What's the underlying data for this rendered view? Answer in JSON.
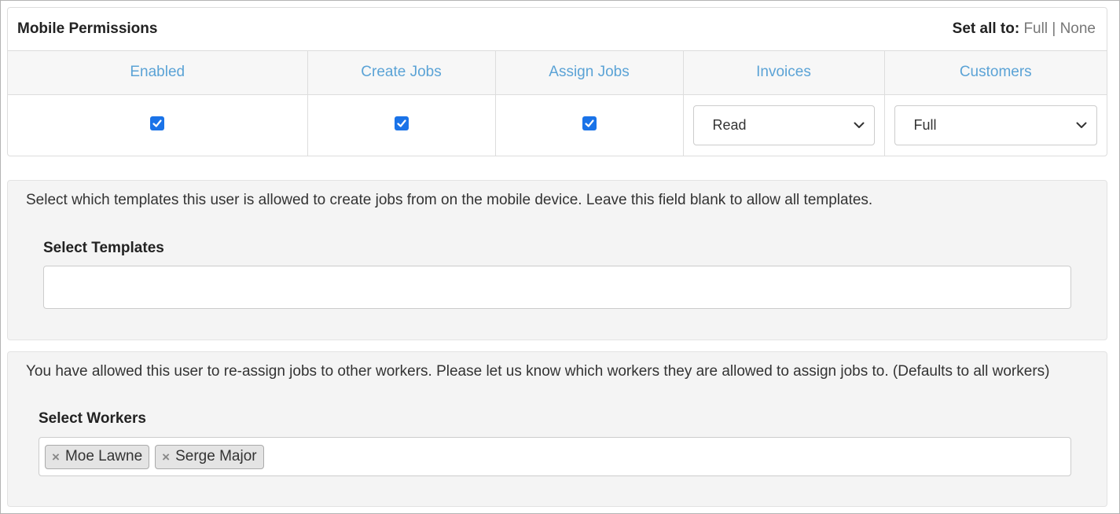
{
  "permissions": {
    "title": "Mobile Permissions",
    "set_all_label": "Set all to:",
    "set_all_full": "Full",
    "set_all_separator": "|",
    "set_all_none": "None",
    "columns": [
      "Enabled",
      "Create Jobs",
      "Assign Jobs",
      "Invoices",
      "Customers"
    ],
    "values": {
      "enabled": true,
      "create_jobs": true,
      "assign_jobs": true,
      "invoices": "Read",
      "customers": "Full"
    }
  },
  "templates": {
    "description": "Select which templates this user is allowed to create jobs from on the mobile device. Leave this field blank to allow all templates.",
    "label": "Select Templates",
    "value": ""
  },
  "workers": {
    "description": "You have allowed this user to re-assign jobs to other workers. Please let us know which workers they are allowed to assign jobs to. (Defaults to all workers)",
    "label": "Select Workers",
    "selected": [
      "Moe Lawne",
      "Serge Major"
    ],
    "remove_glyph": "×"
  },
  "colors": {
    "link_blue": "#5ba3d6",
    "checkbox_blue": "#1a73e8",
    "panel_grey": "#f4f4f4"
  }
}
